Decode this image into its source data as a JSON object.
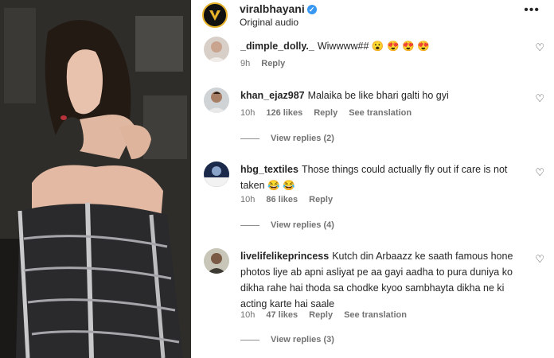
{
  "post": {
    "username": "viralbhayani",
    "audio": "Original audio",
    "more_icon": "more-horizontal-icon"
  },
  "comments": [
    {
      "user": "_dimple_dolly._",
      "text": "Wiwwww## 😮 😍 😍 😍",
      "time": "9h",
      "likes": "",
      "reply": "Reply",
      "translate": "",
      "view_replies": ""
    },
    {
      "user": "khan_ejaz987",
      "text": "Malaika be like bhari galti ho gyi",
      "time": "10h",
      "likes": "126 likes",
      "reply": "Reply",
      "translate": "See translation",
      "view_replies": "View replies (2)"
    },
    {
      "user": "hbg_textiles",
      "text": "Those things could actually fly out if care is not taken 😂 😂",
      "time": "10h",
      "likes": "86 likes",
      "reply": "Reply",
      "translate": "",
      "view_replies": "View replies (4)"
    },
    {
      "user": "livelifelikeprincess",
      "text": "Kutch din Arbaazz ke saath famous hone photos liye ab apni asliyat pe aa gayi aadha to pura duniya ko dikha rahe hai thoda sa chodke kyoo sambhayta dikha ne ki acting karte hai saale",
      "time": "10h",
      "likes": "47 likes",
      "reply": "Reply",
      "translate": "See translation",
      "view_replies": "View replies (3)"
    }
  ]
}
